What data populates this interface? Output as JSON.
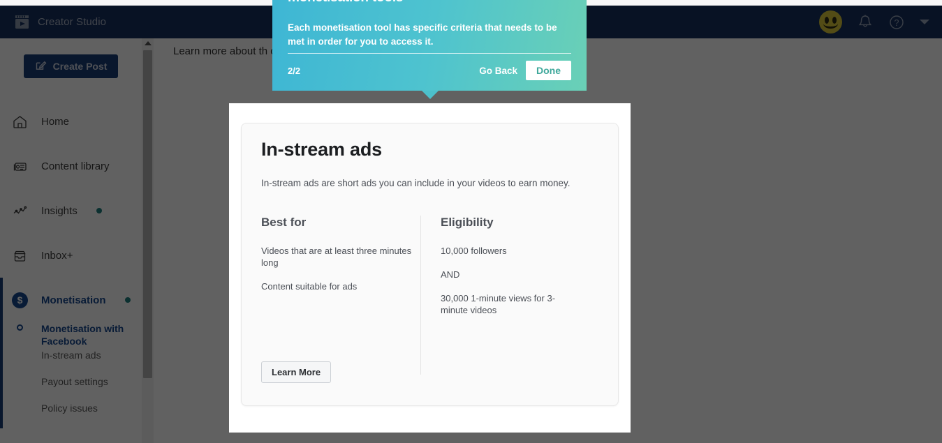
{
  "header": {
    "brand": "Creator Studio",
    "logo_icon": "clapperboard-play-icon",
    "avatar_icon": "smiley-avatar",
    "notifications_icon": "bell-icon",
    "help_icon": "question-circle-icon",
    "account_menu_icon": "chevron-down-icon",
    "background_color": "#16305f"
  },
  "sidebar": {
    "create_post": {
      "label": "Create Post",
      "icon": "compose-pencil-icon"
    },
    "items": [
      {
        "label": "Home",
        "icon": "home-icon",
        "badge": false
      },
      {
        "label": "Content library",
        "icon": "library-icon",
        "badge": false
      },
      {
        "label": "Insights",
        "icon": "insights-chart-icon",
        "badge": true
      },
      {
        "label": "Inbox+",
        "icon": "inbox-icon",
        "badge": false
      }
    ],
    "monetisation": {
      "label": "Monetisation",
      "icon": "dollar-circle-icon",
      "badge": true,
      "active": true,
      "sub_items": [
        {
          "label": "Monetisation with Facebook",
          "icon": "ring-bullet-icon",
          "current": true
        },
        {
          "label": "In-stream ads",
          "current": false
        },
        {
          "label": "Payout settings",
          "current": false
        },
        {
          "label": "Policy issues",
          "current": false
        }
      ]
    },
    "badge_color": "#1f7f7f",
    "accent_color": "#16478f"
  },
  "scrollbar": {
    "up_arrow_icon": "scroll-up-arrow-icon",
    "thumb_name": "scroll-thumb"
  },
  "banner": {
    "text": "Learn more about th                                                     ook."
  },
  "modal": {
    "title": "In-stream ads",
    "subtitle": "In-stream ads are short ads you can include in your videos to earn money.",
    "columns": [
      {
        "heading": "Best for",
        "lines": [
          "Videos that are at least three minutes long",
          "Content suitable for ads"
        ]
      },
      {
        "heading": "Eligibility",
        "lines": [
          "10,000 followers",
          "AND",
          "30,000 1-minute views for 3-minute videos"
        ]
      }
    ],
    "learn_more": "Learn More"
  },
  "tooltip": {
    "title": "monetisation tools",
    "body": "Each monetisation tool has specific criteria that needs to be met in order for you to access it.",
    "step_counter": "2/2",
    "go_back": "Go Back",
    "done": "Done",
    "accent_color": "#4cc0cb",
    "done_text_color": "#3fa89b"
  }
}
